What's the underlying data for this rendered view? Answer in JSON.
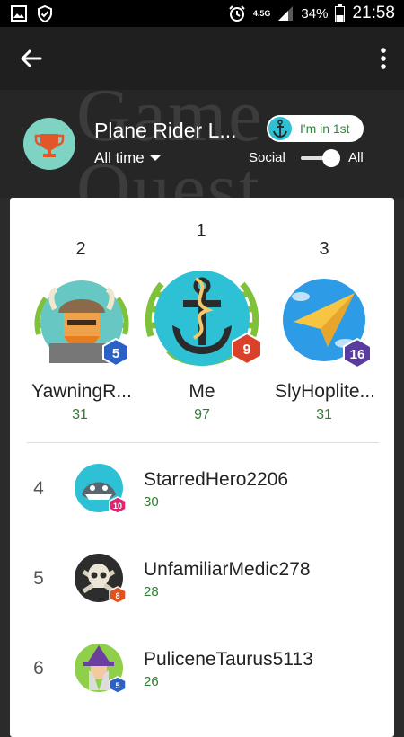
{
  "status_bar": {
    "network": "4.5G",
    "battery": "34%",
    "time": "21:58"
  },
  "header": {
    "title": "Plane Rider L...",
    "time_filter": "All time",
    "rank_chip": "I'm in 1st",
    "toggle_left": "Social",
    "toggle_right": "All",
    "toggle_state": "All"
  },
  "podium": [
    {
      "rank": "2",
      "name": "YawningR...",
      "score": "31",
      "level": "5"
    },
    {
      "rank": "1",
      "name": "Me",
      "score": "97",
      "level": "9"
    },
    {
      "rank": "3",
      "name": "SlyHoplite...",
      "score": "31",
      "level": "16"
    }
  ],
  "list": [
    {
      "rank": "4",
      "name": "StarredHero2206",
      "score": "30",
      "level": "10"
    },
    {
      "rank": "5",
      "name": "UnfamiliarMedic278",
      "score": "28",
      "level": "8"
    },
    {
      "rank": "6",
      "name": "PuliceneTaurus5113",
      "score": "26",
      "level": "5"
    }
  ],
  "colors": {
    "score_green": "#2e7d32",
    "level_blue": "#2b60c7",
    "level_red": "#d9412b",
    "level_purple": "#5a3c9e",
    "level_pink": "#e0246f",
    "level_orange": "#e0531f"
  },
  "icons": [
    "back-arrow-icon",
    "more-vert-icon",
    "trophy-icon",
    "anchor-icon",
    "caret-down-icon"
  ]
}
